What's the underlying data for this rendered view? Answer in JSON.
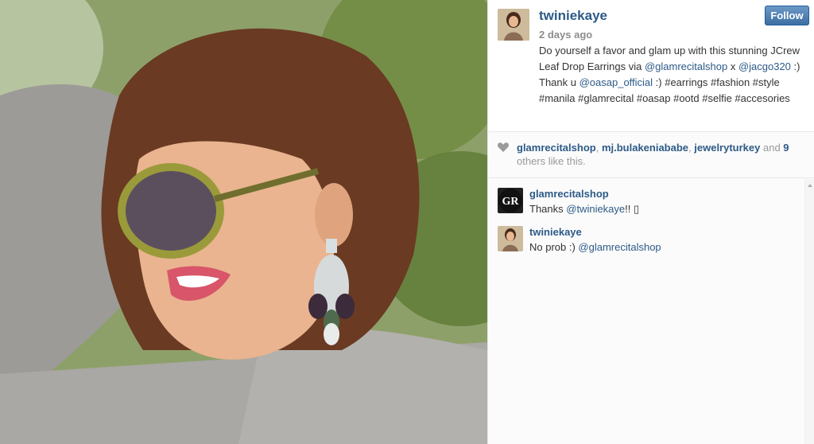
{
  "post": {
    "username": "twiniekaye",
    "time_ago": "2 days ago",
    "follow_label": "Follow",
    "caption_parts": {
      "p1": "Do yourself a favor and glam up with this stunning JCrew Leaf Drop Earrings via ",
      "m1": "@glamrecitalshop",
      "p2": " x ",
      "m2": "@jacgo320",
      "p3": " :) Thank u ",
      "m3": "@oasap_official",
      "p4": " :) #earrings #fashion #style #manila #glamrecital #oasap #ootd #selfie #accesories"
    }
  },
  "likes": {
    "user1": "glamrecitalshop",
    "sep1": ", ",
    "user2": "mj.bulakeniababe",
    "sep2": ", ",
    "user3": "jewelryturkey",
    "and_text": " and ",
    "count": "9",
    "others_text": " others like this."
  },
  "comments": [
    {
      "username": "glamrecitalshop",
      "avatar_initials": "GR",
      "text_prefix": "Thanks ",
      "mention": "@twiniekaye",
      "text_suffix": "!! ▯"
    },
    {
      "username": "twiniekaye",
      "text_prefix": "No prob :) ",
      "mention": "@glamrecitalshop",
      "text_suffix": ""
    }
  ],
  "colors": {
    "link_blue": "#2d5a87",
    "follow_button": "#3d6ea3",
    "muted_gray": "#8e8e8e"
  },
  "icons": {
    "like": "heart-icon",
    "scroll": "scroll-up-arrow-icon"
  }
}
